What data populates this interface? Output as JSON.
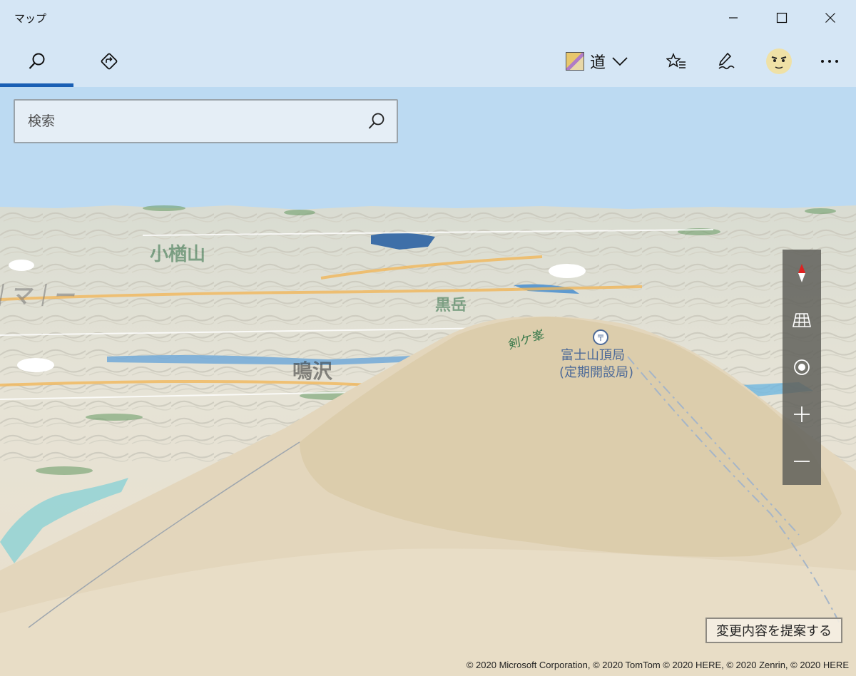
{
  "window": {
    "title": "マップ"
  },
  "toolbar": {
    "search_tab_icon": "search-icon",
    "directions_tab_icon": "directions-icon",
    "map_style_label": "道",
    "favorites_icon": "favorites-icon",
    "ink_icon": "ink-pen-icon",
    "more_icon": "more-icon"
  },
  "search": {
    "placeholder": "検索"
  },
  "map": {
    "labels": {
      "peak": "剣ケ峯",
      "post_office_line1": "富士山頂局",
      "post_office_line2": "(定期開設局)"
    },
    "controls": [
      "compass",
      "tilt",
      "locate",
      "zoom-in",
      "zoom-out"
    ]
  },
  "footer": {
    "suggest_change": "変更内容を提案する",
    "copyright": "© 2020 Microsoft Corporation, © 2020 TomTom © 2020 HERE, © 2020 Zenrin, © 2020 HERE"
  },
  "colors": {
    "accent": "#1a5fb4",
    "titlebar": "#d6e7f4",
    "sky": "#bcdaf2",
    "mountain": "#dccdac",
    "plain": "#eadfc9",
    "post_label": "#4d6a98",
    "peak_label": "#3b7a4c"
  }
}
